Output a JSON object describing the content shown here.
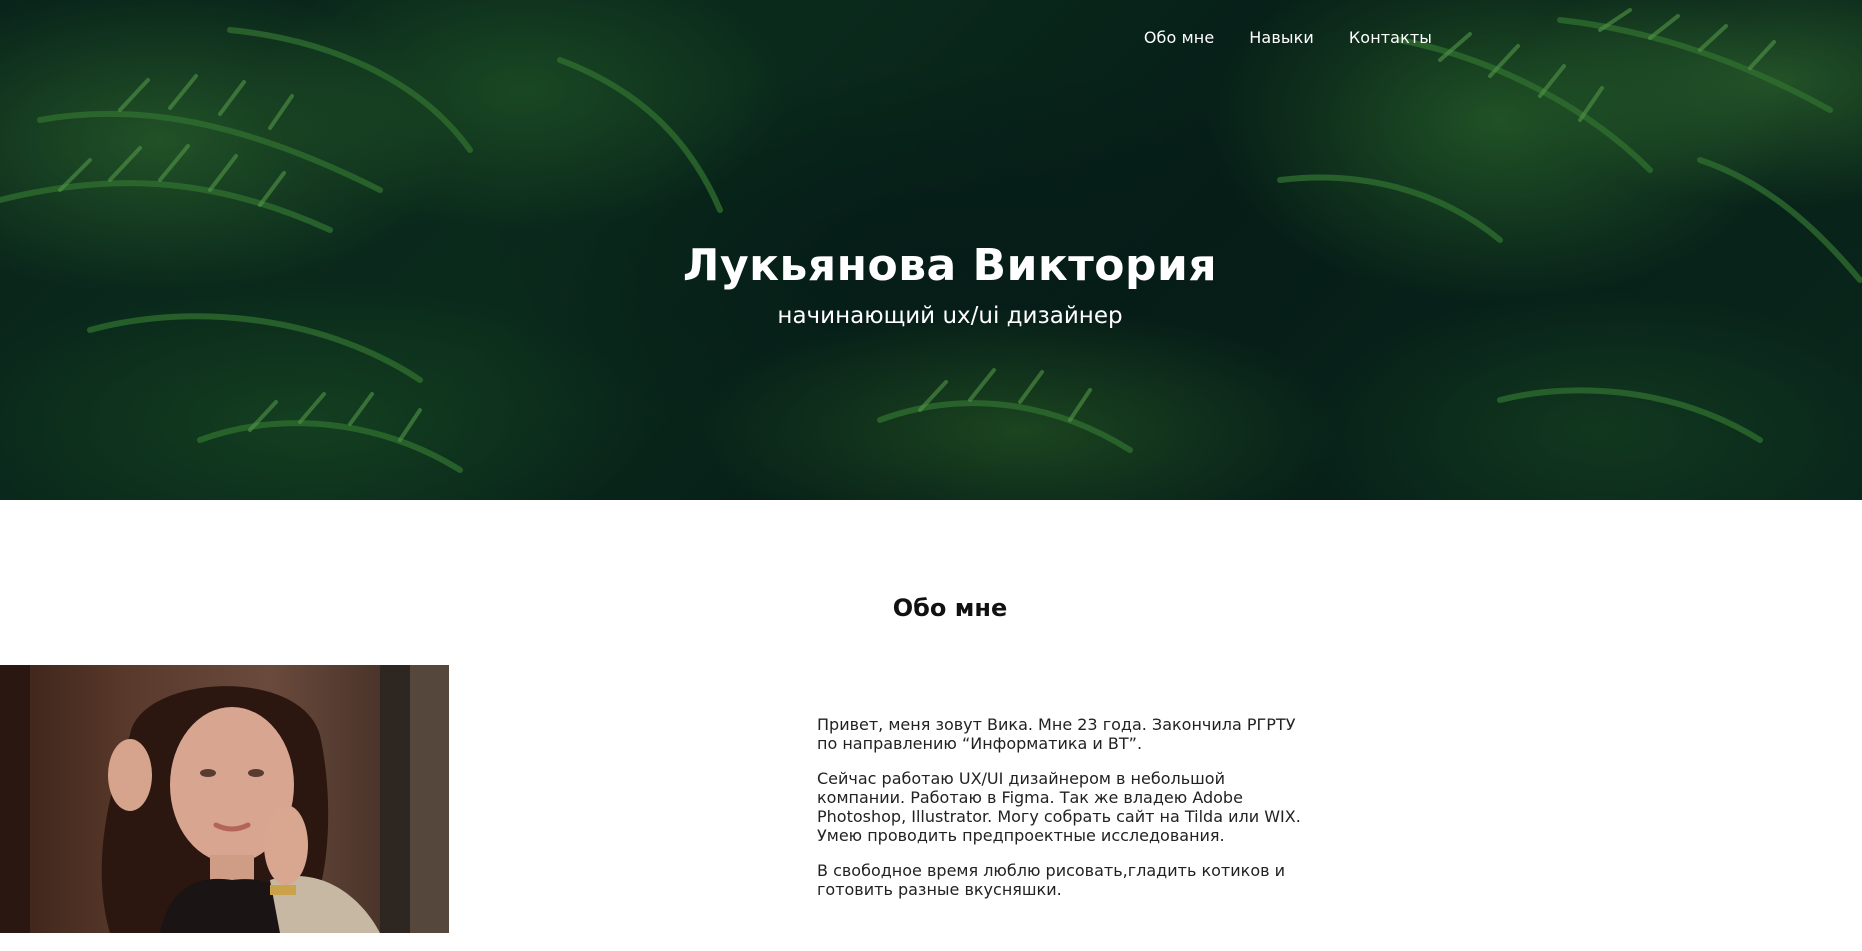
{
  "nav": {
    "items": [
      {
        "label": "Обо мне"
      },
      {
        "label": "Навыки"
      },
      {
        "label": "Контакты"
      }
    ]
  },
  "hero": {
    "title": "Лукьянова Виктория",
    "subtitle": "начинающий ux/ui дизайнер"
  },
  "about": {
    "title": "Обо мне",
    "paragraphs": [
      "Привет, меня зовут Вика. Мне 23 года. Закончила РГРТУ по направлению “Информатика и ВТ”.",
      "Сейчас работаю UX/UI дизайнером в небольшой компании. Работаю в Figma. Так же владею Adobe Photoshop, Illustrator. Могу собрать сайт на Tilda или WIX. Умею проводить предпроектные исследования.",
      "В свободное время люблю рисовать,гладить котиков и готовить разные вкусняшки."
    ]
  },
  "colors": {
    "hero_dark": "#0b2a1e",
    "foliage": "#4fa84a",
    "text_white": "#ffffff"
  }
}
